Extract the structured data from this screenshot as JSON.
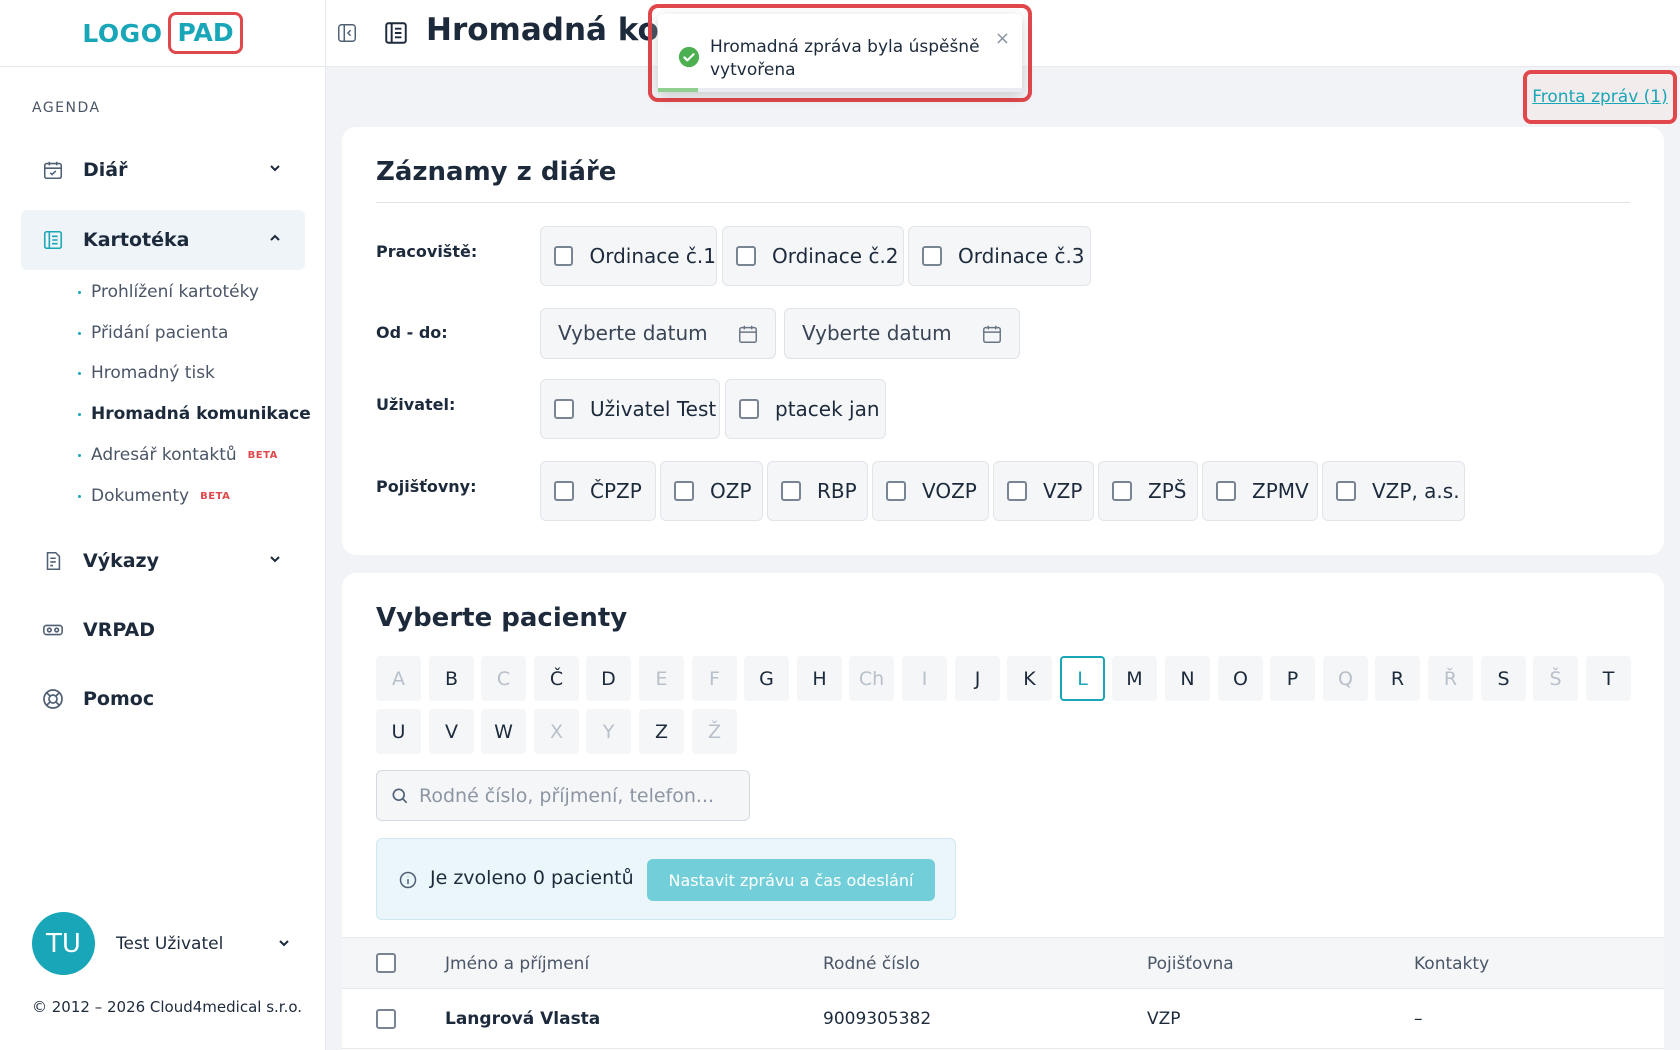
{
  "logo": {
    "left": "LOGO",
    "right": "PAD"
  },
  "sidebar": {
    "section_label": "AGENDA",
    "items": [
      {
        "label": "Diář",
        "icon": "calendar-icon"
      },
      {
        "label": "Kartotéka",
        "icon": "card-index-icon"
      },
      {
        "label": "Výkazy",
        "icon": "report-icon"
      },
      {
        "label": "VRPAD",
        "icon": "vr-headset-icon"
      },
      {
        "label": "Pomoc",
        "icon": "lifebuoy-icon"
      }
    ],
    "subitems": [
      {
        "label": "Prohlížení kartotéky"
      },
      {
        "label": "Přidání pacienta"
      },
      {
        "label": "Hromadný tisk"
      },
      {
        "label": "Hromadná komunikace"
      },
      {
        "label": "Adresář kontaktů",
        "badge": "BETA"
      },
      {
        "label": "Dokumenty",
        "badge": "BETA"
      }
    ],
    "user": {
      "initials": "TU",
      "name": "Test Uživatel"
    },
    "copyright": "© 2012 – 2026 Cloud4medical s.r.o."
  },
  "header": {
    "title": "Hromadná kon"
  },
  "toast": {
    "message": "Hromadná zpráva byla úspěšně vytvořena",
    "close": "×",
    "progress": 0.11
  },
  "queue_link": "Fronta zpráv (1)",
  "filters": {
    "title": "Záznamy z diáře",
    "workplace_label": "Pracoviště:",
    "workplaces": [
      "Ordinace č.1",
      "Ordinace č.2",
      "Ordinace č.3"
    ],
    "date_label": "Od - do:",
    "date_from_placeholder": "Vyberte datum",
    "date_to_placeholder": "Vyberte datum",
    "user_label": "Uživatel:",
    "users": [
      "Uživatel Test",
      "ptacek jan"
    ],
    "insurance_label": "Pojišťovny:",
    "insurances": [
      "ČPZP",
      "OZP",
      "RBP",
      "VOZP",
      "VZP",
      "ZPŠ",
      "ZPMV",
      "VZP, a.s."
    ]
  },
  "patients": {
    "title": "Vyberte pacienty",
    "letters": [
      {
        "l": "A",
        "disabled": true
      },
      {
        "l": "B"
      },
      {
        "l": "C",
        "disabled": true
      },
      {
        "l": "Č"
      },
      {
        "l": "D"
      },
      {
        "l": "E",
        "disabled": true
      },
      {
        "l": "F",
        "disabled": true
      },
      {
        "l": "G"
      },
      {
        "l": "H"
      },
      {
        "l": "Ch",
        "disabled": true
      },
      {
        "l": "I",
        "disabled": true
      },
      {
        "l": "J"
      },
      {
        "l": "K"
      },
      {
        "l": "L",
        "selected": true
      },
      {
        "l": "M"
      },
      {
        "l": "N"
      },
      {
        "l": "O"
      },
      {
        "l": "P"
      },
      {
        "l": "Q",
        "disabled": true
      },
      {
        "l": "R"
      },
      {
        "l": "Ř",
        "disabled": true
      },
      {
        "l": "S"
      },
      {
        "l": "Š",
        "disabled": true
      },
      {
        "l": "T"
      },
      {
        "l": "U"
      },
      {
        "l": "V"
      },
      {
        "l": "W"
      },
      {
        "l": "X",
        "disabled": true
      },
      {
        "l": "Y",
        "disabled": true
      },
      {
        "l": "Z"
      },
      {
        "l": "Ž",
        "disabled": true
      }
    ],
    "search_placeholder": "Rodné číslo, příjmení, telefon...",
    "selected_info": "Je zvoleno 0 pacientů",
    "set_message_button": "Nastavit zprávu a čas odeslání",
    "columns": [
      "Jméno a příjmení",
      "Rodné číslo",
      "Pojišťovna",
      "Kontakty"
    ],
    "rows": [
      {
        "name": "Langrová Vlasta",
        "birth_number": "9009305382",
        "insurance": "VZP",
        "contacts": "–"
      }
    ]
  },
  "colors": {
    "accent": "#18a6b8",
    "highlight": "#e0484c",
    "success": "#4caf50"
  }
}
